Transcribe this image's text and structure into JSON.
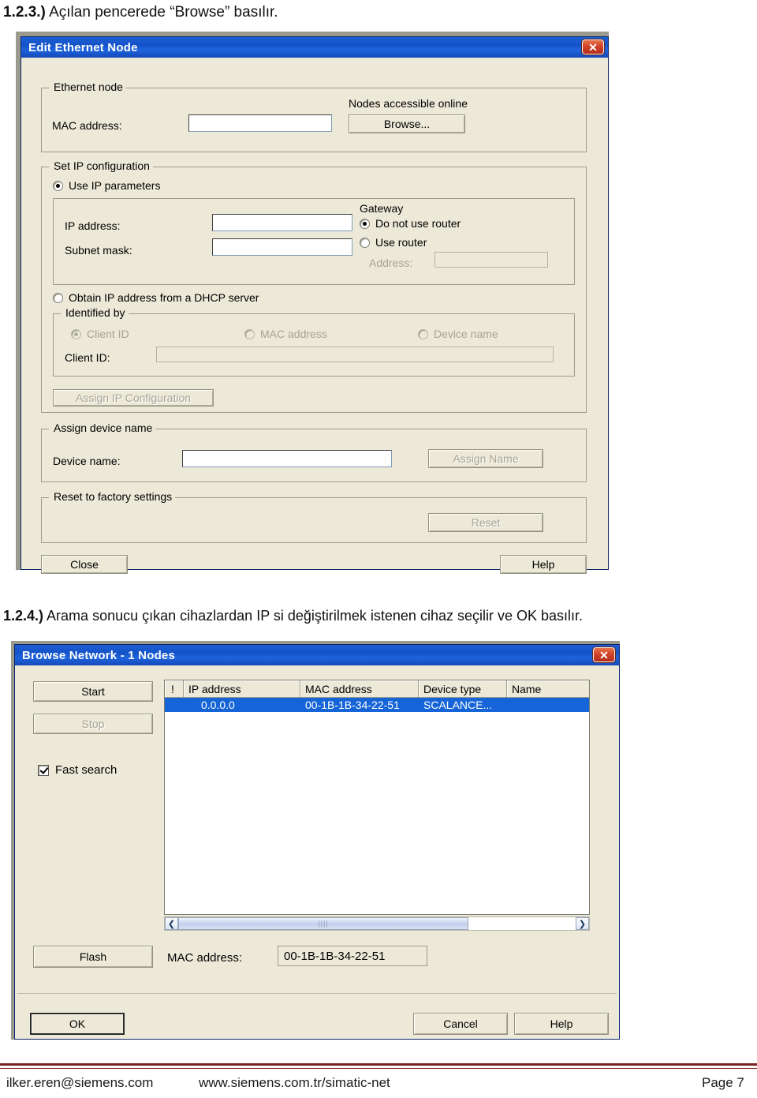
{
  "document": {
    "step_1": {
      "number": "1.2.3.)",
      "text": "Açılan pencerede “Browse” basılır."
    },
    "step_2": {
      "number": "1.2.4.)",
      "text": "Arama sonucu çıkan cihazlardan IP si değiştirilmek istenen cihaz seçilir ve OK basılır."
    }
  },
  "footer": {
    "email": "ilker.eren@siemens.com",
    "website": "www.siemens.com.tr/simatic-net",
    "page": "Page 7",
    "rule_color": "#7b2222"
  },
  "edit_ethernet_node_dialog": {
    "title": "Edit Ethernet Node",
    "close_label": "✕",
    "ethernet_node_group": {
      "legend": "Ethernet node",
      "mac_label": "MAC address:",
      "mac_value": "",
      "nodes_online_label": "Nodes accessible online",
      "browse_button": "Browse..."
    },
    "set_ip_group": {
      "legend": "Set IP configuration",
      "use_ip_parameters": "Use IP parameters",
      "ip_address_label": "IP address:",
      "ip_address_value": "",
      "subnet_mask_label": "Subnet mask:",
      "subnet_mask_value": "",
      "gateway_legend": "Gateway",
      "do_not_use_router": "Do not use router",
      "use_router": "Use router",
      "address_label": "Address:",
      "address_value": "",
      "obtain_dhcp": "Obtain IP address from a DHCP server",
      "identified_by_legend": "Identified by",
      "client_id_radio": "Client ID",
      "mac_address_radio": "MAC address",
      "device_name_radio": "Device name",
      "client_id_label": "Client ID:",
      "client_id_value": "",
      "assign_ip_button": "Assign IP Configuration"
    },
    "assign_device_name_group": {
      "legend": "Assign device name",
      "device_name_label": "Device name:",
      "device_name_value": "",
      "assign_name_button": "Assign Name"
    },
    "reset_group": {
      "legend": "Reset to factory settings",
      "reset_button": "Reset"
    },
    "footer_buttons": {
      "close": "Close",
      "help": "Help"
    }
  },
  "browse_network_dialog": {
    "title": "Browse Network - 1 Nodes",
    "close_label": "✕",
    "start_button": "Start",
    "stop_button": "Stop",
    "fast_search_label": "Fast search",
    "list": {
      "columns": [
        "!",
        "IP address",
        "MAC address",
        "Device type",
        "Name"
      ],
      "rows": [
        {
          "flag": "",
          "ip_address": "0.0.0.0",
          "mac_address": "00-1B-1B-34-22-51",
          "device_type": "SCALANCE...",
          "name": ""
        }
      ]
    },
    "scroll_left_icon": "❮",
    "scroll_right_icon": "❯",
    "flash_button": "Flash",
    "mac_address_label": "MAC address:",
    "mac_address_value": "00-1B-1B-34-22-51",
    "ok_button": "OK",
    "cancel_button": "Cancel",
    "help_button": "Help"
  }
}
